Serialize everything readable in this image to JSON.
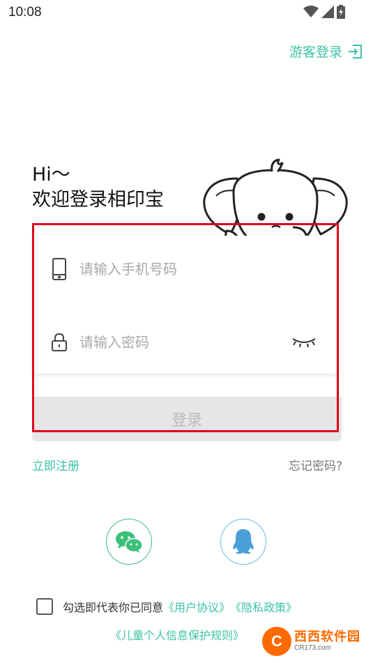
{
  "status_bar": {
    "time": "10:08",
    "icons": [
      "wifi-icon",
      "cell-signal-icon",
      "battery-icon"
    ]
  },
  "header": {
    "guest_login_label": "游客登录"
  },
  "greeting": {
    "line1": "Hi～",
    "line2": "欢迎登录相印宝"
  },
  "form": {
    "phone_placeholder": "请输入手机号码",
    "phone_value": "",
    "password_placeholder": "请输入密码",
    "password_value": "",
    "login_label": "登录"
  },
  "links": {
    "register": "立即注册",
    "forgot_password": "忘记密码?"
  },
  "social": {
    "icons": [
      "wechat-icon",
      "qq-icon"
    ]
  },
  "agreement": {
    "prefix": "勾选即代表你已同意",
    "user_agreement": "《用户协议》",
    "privacy_policy": "《隐私政策》",
    "child_privacy": "《儿童个人信息保护规则》"
  },
  "watermark": {
    "badge": "C",
    "main": "西西软件园",
    "sub": "CR173.com"
  },
  "colors": {
    "accent": "#3cc2a6",
    "wechat": "#3bbf7a",
    "qq": "#6ab8e6",
    "highlight": "#e0001b"
  }
}
